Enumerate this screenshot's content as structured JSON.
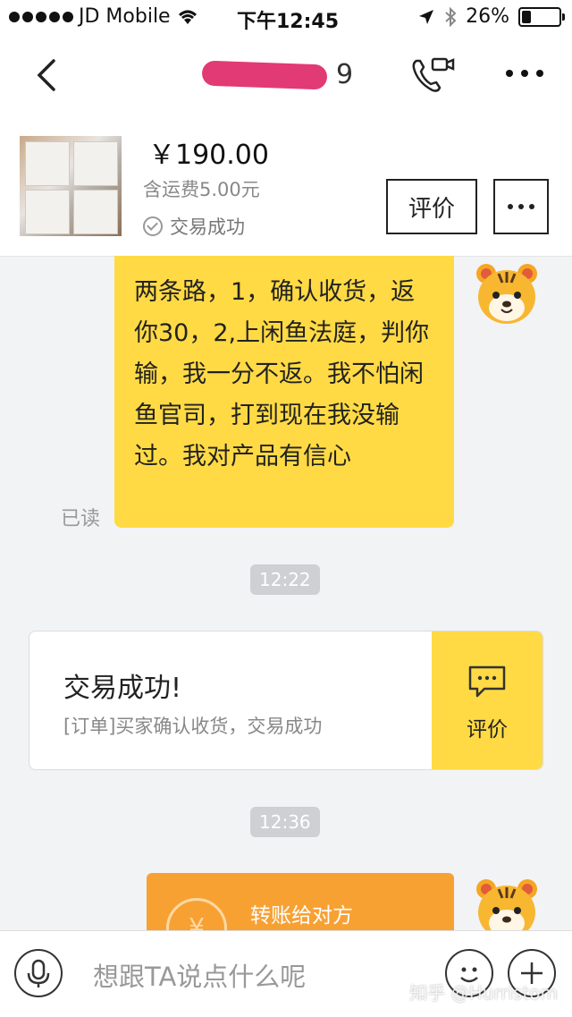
{
  "status_bar": {
    "carrier": "JD Mobile",
    "time": "下午12:45",
    "battery": "26%",
    "battery_level": 0.26
  },
  "nav": {
    "title_visible_tail": "9"
  },
  "product": {
    "price": "￥190.00",
    "shipping": "含运费5.00元",
    "status": "交易成功",
    "rate_button": "评价"
  },
  "messages": {
    "seller_text": "两条路，1，确认收货，返你30，2,上闲鱼法庭，判你输，我一分不返。我不怕闲鱼官司，打到现在我没输过。我对产品有信心",
    "read_label": "已读",
    "time_1": "12:22",
    "time_2": "12:36",
    "deal_card": {
      "title": "交易成功!",
      "subtitle": "[订单]买家确认收货，交易成功",
      "action": "评价"
    },
    "transfer_label": "转账给对方"
  },
  "input": {
    "placeholder": "想跟TA说点什么呢"
  },
  "watermark": "知乎 @Hurristom",
  "colors": {
    "bubble": "#ffda44",
    "transfer": "#f8a133",
    "blur_mark": "#e23a74"
  }
}
